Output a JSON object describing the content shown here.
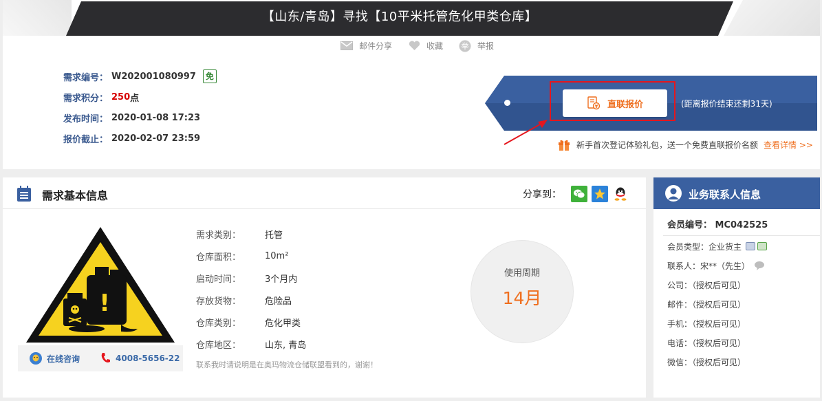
{
  "header": {
    "title": "【山东/青岛】寻找【10平米托管危化甲类仓库】"
  },
  "actions": [
    {
      "label": "邮件分享",
      "icon": "mail-icon"
    },
    {
      "label": "收藏",
      "icon": "heart-icon"
    },
    {
      "label": "举报",
      "icon": "report-icon"
    }
  ],
  "summary": {
    "demand_no_label": "需求编号：",
    "demand_no": "W202001080997",
    "free_badge": "免",
    "points_label": "需求积分：",
    "points_value": "250",
    "points_unit": "点",
    "publish_label": "发布时间：",
    "publish_time": "2020-01-08 17:23",
    "deadline_label": "报价截止：",
    "deadline_time": "2020-02-07 23:59"
  },
  "quote": {
    "button_label": "直联报价",
    "countdown": "(距离报价结束还剩31天)",
    "gift_text": "新手首次登记体验礼包，送一个免费直联报价名额",
    "gift_link": "查看详情 >>"
  },
  "panel": {
    "title": "需求基本信息",
    "share_label": "分享到：",
    "share_icons": [
      "wechat-icon",
      "qzone-icon",
      "qq-icon"
    ],
    "online_consult": "在线咨询",
    "phone": "4008-5656-22",
    "details": [
      {
        "key": "需求类别：",
        "value": "托管"
      },
      {
        "key": "仓库面积：",
        "value": "10m²"
      },
      {
        "key": "启动时间：",
        "value": "3个月内"
      },
      {
        "key": "存放货物：",
        "value": "危险品"
      },
      {
        "key": "仓库类别：",
        "value": "危化甲类"
      },
      {
        "key": "仓库地区：",
        "value": "山东, 青岛"
      }
    ],
    "notice": "联系我时请说明是在奥玛物流仓储联盟看到的，谢谢！",
    "cycle_label": "使用周期",
    "cycle_value": "14月"
  },
  "contact": {
    "title": "业务联系人信息",
    "member_no": "会员编号： MC042525",
    "rows": [
      "会员类型：企业货主",
      "联系人：宋**（先生）",
      "公司：（授权后可见）",
      "邮件：（授权后可见）",
      "手机：（授权后可见）",
      "电话：（授权后可见）",
      "微信：（授权后可见）"
    ]
  },
  "colors": {
    "brand_blue": "#3a60a0",
    "accent_orange": "#ef6f1f",
    "title_bar": "#2c2c2f",
    "highlight_red": "#e5161d"
  }
}
